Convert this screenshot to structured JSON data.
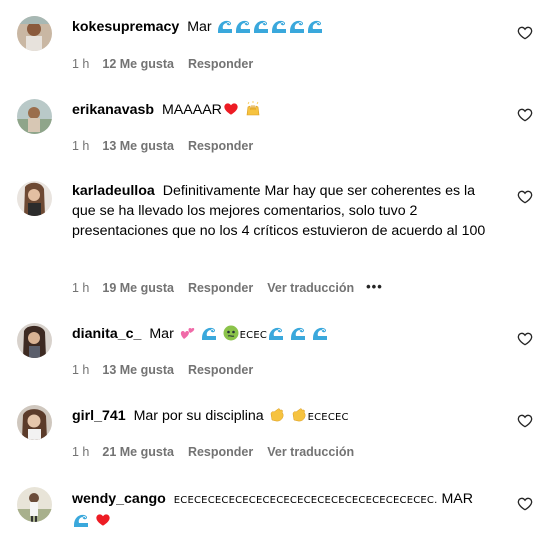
{
  "comments": [
    {
      "username": "kokesupremacy",
      "text_before": "Mar",
      "time": "1 h",
      "likes": "12 Me gusta",
      "reply": "Responder"
    },
    {
      "username": "erikanavasb",
      "text_before": "MAAAAR",
      "time": "1 h",
      "likes": "13 Me gusta",
      "reply": "Responder"
    },
    {
      "username": "karladeulloa",
      "text_before": "Definitivamente Mar hay que ser coherentes es la que se ha llevado los mejores comentarios, solo tuvo 2 presentaciones que no los 4 críticos estuvieron de acuerdo al 100",
      "time": "1 h",
      "likes": "19 Me gusta",
      "reply": "Responder",
      "translate": "Ver traducción",
      "more": "•••"
    },
    {
      "username": "dianita_c_",
      "text_before": "Mar",
      "ecec": "ECEC",
      "time": "1 h",
      "likes": "13 Me gusta",
      "reply": "Responder"
    },
    {
      "username": "girl_741",
      "text_before": "Mar por su disciplina",
      "ecec": "ECECEC",
      "time": "1 h",
      "likes": "21 Me gusta",
      "reply": "Responder",
      "translate": "Ver traducción"
    },
    {
      "username": "wendy_cango",
      "ecec": "ECECECECECECECECECECECECECECECECECECEC.",
      "text_after": "MAR"
    }
  ],
  "colors": {
    "meta": "#737373",
    "heart_red": "#ed1c24",
    "wave_blue": "#3aa8dc"
  }
}
